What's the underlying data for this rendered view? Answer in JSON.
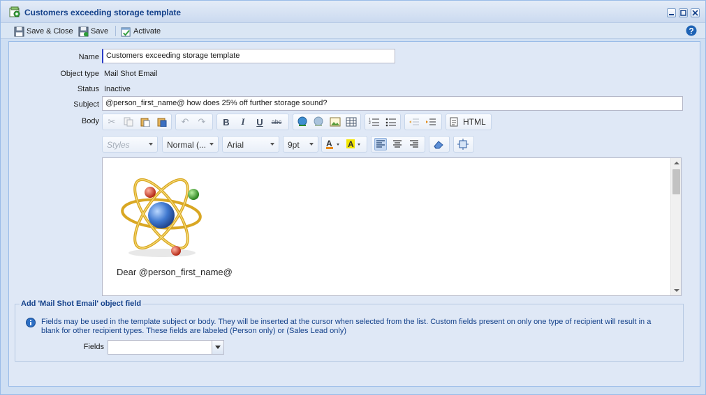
{
  "window": {
    "title": "Customers exceeding storage template",
    "icon": "template-icon"
  },
  "toolbar": {
    "save_close_label": "Save & Close",
    "save_label": "Save",
    "activate_label": "Activate"
  },
  "form": {
    "name_label": "Name",
    "name_value": "Customers exceeding storage template",
    "object_type_label": "Object type",
    "object_type_value": "Mail Shot Email",
    "status_label": "Status",
    "status_value": "Inactive",
    "subject_label": "Subject",
    "subject_value": "@person_first_name@ how does 25% off further storage sound?",
    "body_label": "Body"
  },
  "editor": {
    "html_label": "HTML",
    "styles_combo": "Styles",
    "format_combo": "Normal (...",
    "font_combo": "Arial",
    "size_combo": "9pt",
    "content_text": "Dear @person_first_name@"
  },
  "add_field": {
    "legend": "Add 'Mail Shot Email' object field",
    "info_text": "Fields may be used in the template subject or body. They will be inserted at the cursor when selected from the list. Custom fields present on only one type of recipient will result in a blank for other recipient types. These fields are labeled (Person only) or (Sales Lead only)",
    "fields_label": "Fields",
    "fields_value": ""
  },
  "colors": {
    "accent": "#15428b",
    "panel": "#dfe8f6"
  }
}
